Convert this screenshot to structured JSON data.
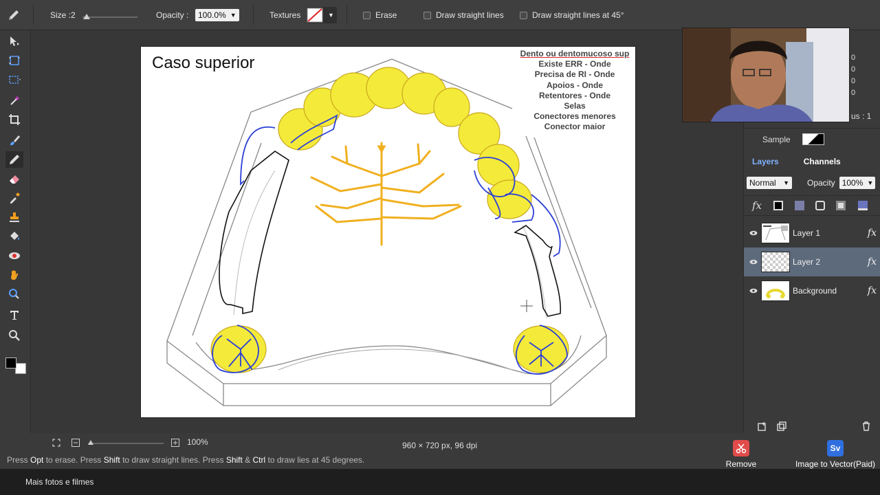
{
  "optbar": {
    "size_label": "Size :2",
    "opacity_label": "Opacity :",
    "opacity_value": "100.0%",
    "textures_label": "Textures",
    "erase_label": "Erase",
    "straight_label": "Draw straight lines",
    "straight45_label": "Draw straight lines at 45°"
  },
  "canvas": {
    "title": "Caso superior",
    "notes": [
      "Dento ou dentomucoso sup",
      "Existe ERR - Onde",
      "Precisa de RI - Onde",
      "Apoios - Onde",
      "Retentores - Onde",
      "Selas",
      "Conectores menores",
      "Conector maior"
    ]
  },
  "info_panel": {
    "numbers": [
      "0",
      "0",
      "0",
      "0"
    ],
    "clipped_text": "us : 1",
    "sample_label": "Sample"
  },
  "layers_panel": {
    "tabs": [
      "Layers",
      "Channels"
    ],
    "blend_mode": "Normal",
    "opacity_label": "Opacity",
    "opacity_value": "100%",
    "fx_symbol": "fx",
    "layers": [
      {
        "name": "Layer 1",
        "selected": false
      },
      {
        "name": "Layer 2",
        "selected": true
      },
      {
        "name": "Background",
        "selected": false
      }
    ]
  },
  "zoombar": {
    "zoom": "100%",
    "doc_info": "960 × 720 px, 96 dpi"
  },
  "status": {
    "p1": "Press ",
    "k1": "Opt",
    "p2": " to erase. Press ",
    "k2": "Shift",
    "p3": " to draw straight lines. Press ",
    "k3": "Shift",
    "p4": " & ",
    "k4": "Ctrl",
    "p5": " to draw lies at 45 degrees."
  },
  "addons": {
    "remove_bg": "Remove Background(Paid)",
    "to_vector": "Image to Vector(Paid)",
    "sv_badge": "Sv"
  },
  "osbar": {
    "label": "Mais fotos e filmes"
  },
  "colors": {
    "accent_tab": "#7fb2ff",
    "selected_layer": "#5d6a7c",
    "tooth_yellow": "#f4ea3a",
    "clasp_blue": "#2a3fd6",
    "connector_gold": "#f0b020"
  }
}
